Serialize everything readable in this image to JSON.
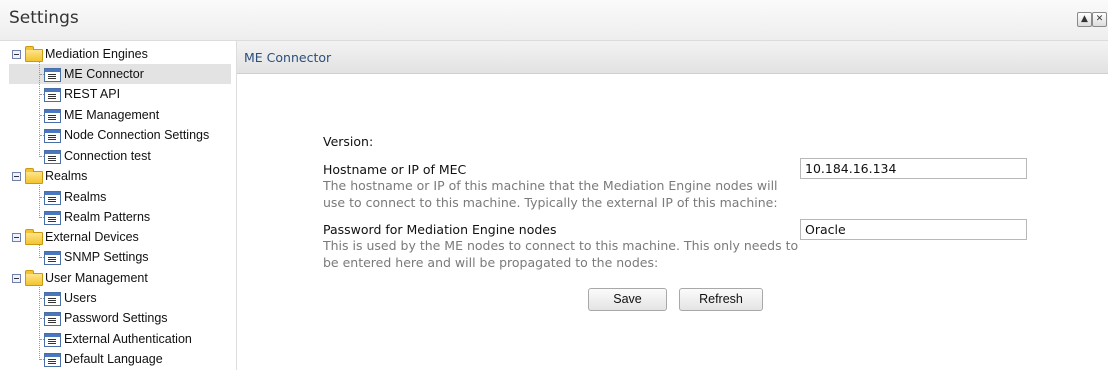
{
  "window": {
    "title": "Settings",
    "buttons": {
      "collapse_icon": "triangle-up-icon",
      "close_icon": "close-icon",
      "collapse_glyph": "▲",
      "close_glyph": "✕"
    }
  },
  "tree": {
    "selected": "ME Connector",
    "groups": [
      {
        "label": "Mediation Engines",
        "children": [
          "ME Connector",
          "REST API",
          "ME Management",
          "Node Connection Settings",
          "Connection test"
        ]
      },
      {
        "label": "Realms",
        "children": [
          "Realms",
          "Realm Patterns"
        ]
      },
      {
        "label": "External Devices",
        "children": [
          "SNMP Settings"
        ]
      },
      {
        "label": "User Management",
        "children": [
          "Users",
          "Password Settings",
          "External Authentication",
          "Default Language"
        ]
      }
    ]
  },
  "panel": {
    "title": "ME Connector",
    "version_label": "Version:",
    "hostname": {
      "label": "Hostname or IP of MEC",
      "description": "The hostname or IP of this machine that the Mediation Engine nodes will use to connect to this machine. Typically the external IP of this machine:",
      "value": "10.184.16.134"
    },
    "password": {
      "label": "Password for Mediation Engine nodes",
      "description": "This is used by the ME nodes to connect to this machine. This only needs to be entered here and will be propagated to the nodes:",
      "value": "Oracle"
    },
    "buttons": {
      "save": "Save",
      "refresh": "Refresh"
    }
  }
}
